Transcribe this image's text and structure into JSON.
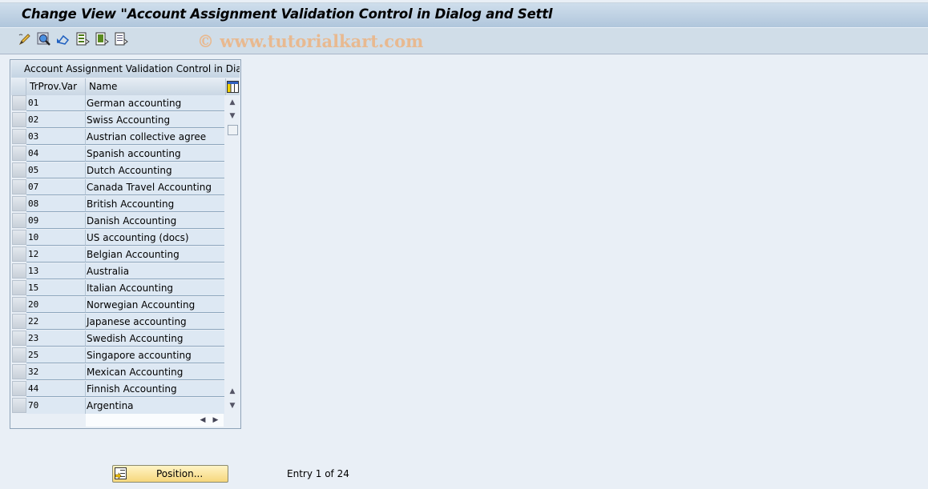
{
  "window": {
    "title": "Change View \"Account Assignment Validation Control in Dialog and Settl"
  },
  "toolbar": {
    "icons": [
      "edit-pencil-icon",
      "display-change-icon",
      "undo-icon",
      "select-all-icon",
      "select-block-icon",
      "deselect-all-icon"
    ],
    "watermark": "© www.tutorialkart.com"
  },
  "table": {
    "title": "Account Assignment Validation Control in Dialo...",
    "columns": [
      "TrProv.Var",
      "Name"
    ],
    "rows": [
      {
        "key": "01",
        "name": "German accounting"
      },
      {
        "key": "02",
        "name": "Swiss Accounting"
      },
      {
        "key": "03",
        "name": "Austrian collective agree"
      },
      {
        "key": "04",
        "name": "Spanish accounting"
      },
      {
        "key": "05",
        "name": "Dutch Accounting"
      },
      {
        "key": "07",
        "name": "Canada Travel Accounting"
      },
      {
        "key": "08",
        "name": "British Accounting"
      },
      {
        "key": "09",
        "name": "Danish Accounting"
      },
      {
        "key": "10",
        "name": "US accounting (docs)"
      },
      {
        "key": "12",
        "name": "Belgian Accounting"
      },
      {
        "key": "13",
        "name": "Australia"
      },
      {
        "key": "15",
        "name": "Italian Accounting"
      },
      {
        "key": "20",
        "name": "Norwegian Accounting"
      },
      {
        "key": "22",
        "name": "Japanese accounting"
      },
      {
        "key": "23",
        "name": "Swedish Accounting"
      },
      {
        "key": "25",
        "name": "Singapore accounting"
      },
      {
        "key": "32",
        "name": "Mexican Accounting"
      },
      {
        "key": "44",
        "name": "Finnish Accounting"
      },
      {
        "key": "70",
        "name": "Argentina"
      }
    ]
  },
  "footer": {
    "position_button": "Position...",
    "entry_text": "Entry 1 of 24"
  },
  "colors": {
    "title_gradient_top": "#cfdeec",
    "toolbar_bg": "#d0dde8",
    "cell_bg": "#dde8f3",
    "button_yellow": "#f6d77c",
    "watermark": "#e8b990"
  }
}
